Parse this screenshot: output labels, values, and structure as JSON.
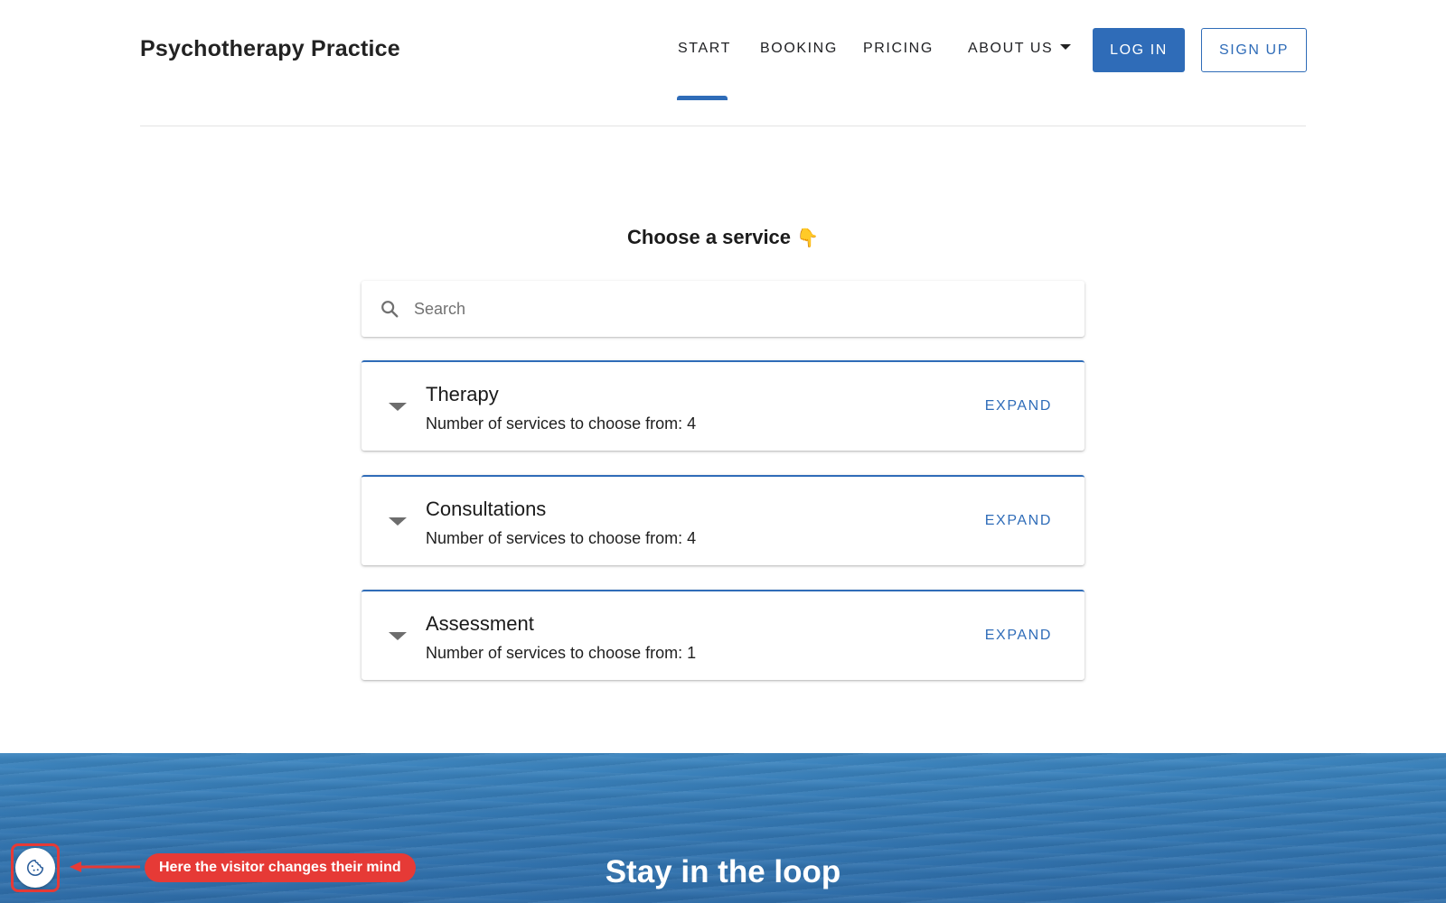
{
  "header": {
    "brand": "Psychotherapy Practice",
    "nav": {
      "start": "START",
      "booking": "BOOKING",
      "pricing": "PRICING",
      "about": "ABOUT US"
    },
    "login_label": "LOG IN",
    "signup_label": "SIGN UP",
    "active_nav": "START"
  },
  "main": {
    "title": "Choose a service",
    "title_emoji": "👇",
    "search": {
      "placeholder": "Search",
      "value": ""
    },
    "cards": [
      {
        "title": "Therapy",
        "subtitle": "Number of services to choose from: 4",
        "action": "EXPAND"
      },
      {
        "title": "Consultations",
        "subtitle": "Number of services to choose from: 4",
        "action": "EXPAND"
      },
      {
        "title": "Assessment",
        "subtitle": "Number of services to choose from: 1",
        "action": "EXPAND"
      }
    ]
  },
  "footer_band": {
    "title": "Stay in the loop"
  },
  "annotation": {
    "text": "Here the visitor changes their mind"
  },
  "colors": {
    "accent": "#2f6cb8",
    "annotation_red": "#e63a36"
  },
  "icons": {
    "search": "search-icon",
    "cookie": "cookie-icon",
    "dropdown": "caret-down-icon",
    "card_toggle": "triangle-down-icon"
  }
}
